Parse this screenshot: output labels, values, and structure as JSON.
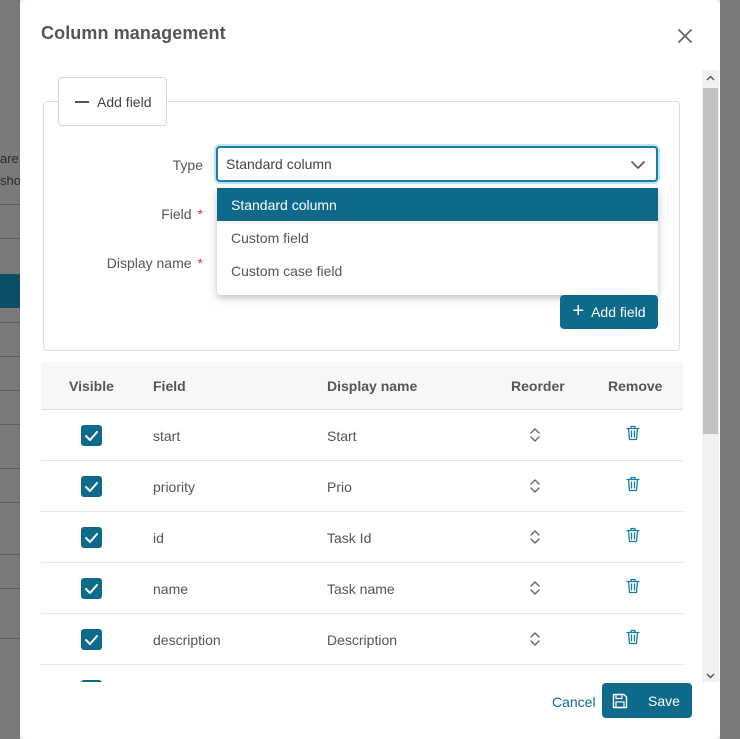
{
  "background": {
    "text_fragments": [
      "are",
      "sho"
    ]
  },
  "modal": {
    "title": "Column management",
    "close_icon": "close-icon"
  },
  "add_field_section": {
    "legend_label": "Add field",
    "type_label": "Type",
    "field_label": "Field",
    "display_name_label": "Display name",
    "required_marker": "*",
    "type_selected": "Standard column",
    "type_options": [
      "Standard column",
      "Custom field",
      "Custom case field"
    ],
    "add_button_label": "Add field"
  },
  "table": {
    "headers": {
      "visible": "Visible",
      "field": "Field",
      "display_name": "Display name",
      "reorder": "Reorder",
      "remove": "Remove"
    },
    "rows": [
      {
        "visible": true,
        "field": "start",
        "display_name": "Start"
      },
      {
        "visible": true,
        "field": "priority",
        "display_name": "Prio"
      },
      {
        "visible": true,
        "field": "id",
        "display_name": "Task Id"
      },
      {
        "visible": true,
        "field": "name",
        "display_name": "Task name"
      },
      {
        "visible": true,
        "field": "description",
        "display_name": "Description"
      }
    ]
  },
  "footer": {
    "cancel_label": "Cancel",
    "save_label": "Save"
  },
  "colors": {
    "primary": "#0d6a8b",
    "required": "#d0342c",
    "focus_ring": "#bfe3ef"
  }
}
